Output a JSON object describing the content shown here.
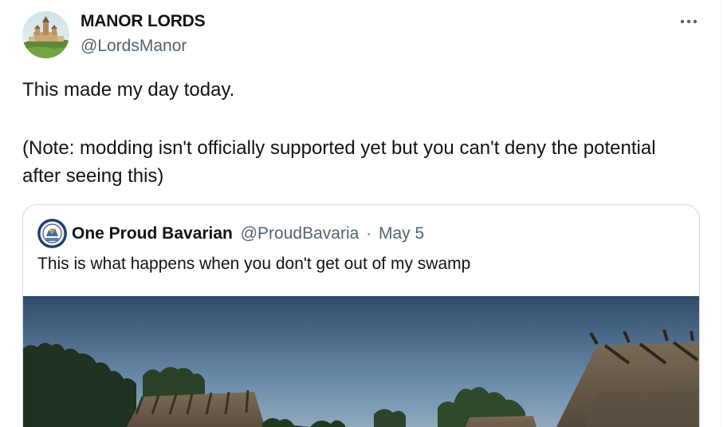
{
  "tweet": {
    "author": {
      "display_name": "MANOR LORDS",
      "handle": "@LordsManor",
      "avatar_icon": "castle-town-avatar"
    },
    "more_icon": "ellipsis-icon",
    "text_line1": "This made my day today.",
    "text_line2": "(Note: modding isn't officially supported yet but you can't deny the potential after seeing this)"
  },
  "quote": {
    "author": {
      "display_name": "One Proud Bavarian",
      "handle": "@ProudBavaria",
      "separator": "·",
      "date": "May 5",
      "avatar_icon": "bavarian-seal-avatar"
    },
    "text": "This is what happens when you don't get out of my swamp",
    "media_icon": "medieval-village-image"
  },
  "colors": {
    "text_primary": "#0f1419",
    "text_secondary": "#536471",
    "border": "#cfd9de"
  }
}
